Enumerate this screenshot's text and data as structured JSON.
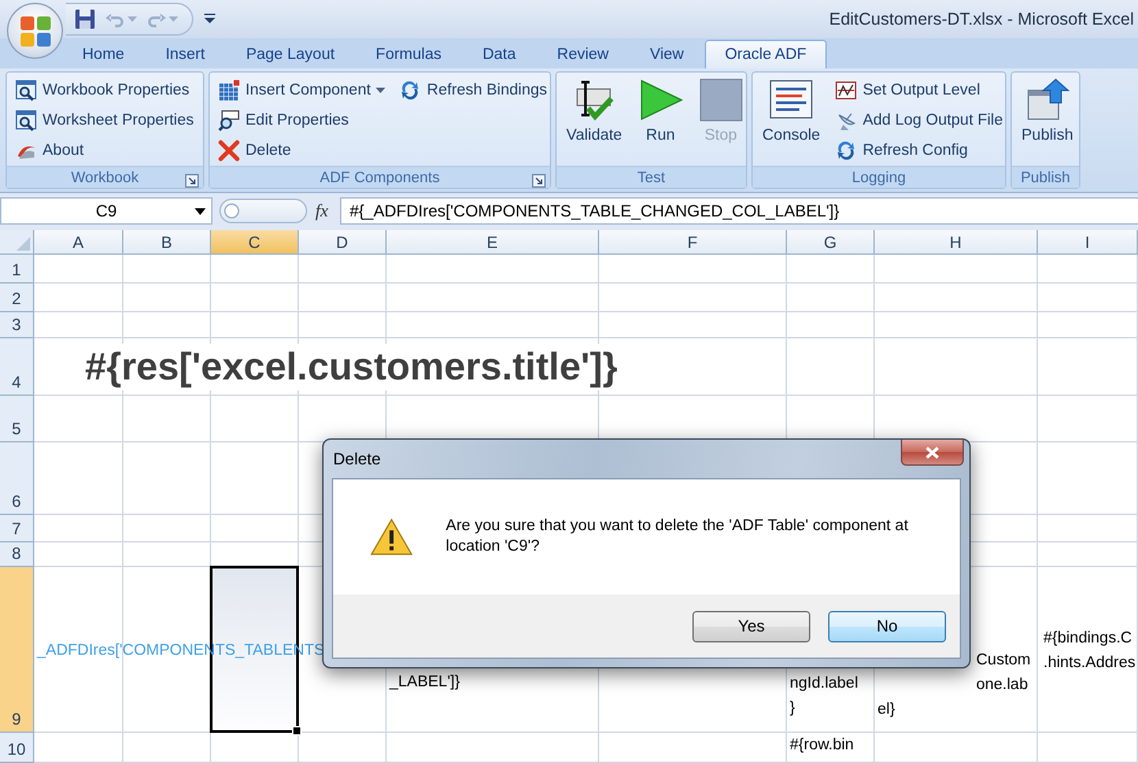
{
  "window": {
    "title": "EditCustomers-DT.xlsx - Microsoft Excel"
  },
  "tabs": [
    {
      "label": "Home",
      "selected": false
    },
    {
      "label": "Insert",
      "selected": false
    },
    {
      "label": "Page Layout",
      "selected": false
    },
    {
      "label": "Formulas",
      "selected": false
    },
    {
      "label": "Data",
      "selected": false
    },
    {
      "label": "Review",
      "selected": false
    },
    {
      "label": "View",
      "selected": false
    },
    {
      "label": "Oracle ADF",
      "selected": true
    }
  ],
  "ribbon_groups": [
    {
      "title": "Workbook",
      "launcher": true,
      "items": [
        {
          "label": "Workbook Properties",
          "kind": "small"
        },
        {
          "label": "Worksheet Properties",
          "kind": "small"
        },
        {
          "label": "About",
          "kind": "small"
        }
      ]
    },
    {
      "title": "ADF Components",
      "launcher": true,
      "items": [
        {
          "label": "Insert Component",
          "kind": "small",
          "dropdown": true
        },
        {
          "label": "Edit Properties",
          "kind": "small",
          "dropdown": false
        },
        {
          "label": "Delete",
          "kind": "small",
          "dropdown": false
        },
        {
          "label": "Refresh Bindings",
          "kind": "small",
          "dropdown": false
        }
      ]
    },
    {
      "title": "Test",
      "launcher": false,
      "items": [
        {
          "label": "Validate",
          "kind": "large",
          "disabled": false
        },
        {
          "label": "Run",
          "kind": "large",
          "disabled": false
        },
        {
          "label": "Stop",
          "kind": "large",
          "disabled": true
        }
      ]
    },
    {
      "title": "Logging",
      "launcher": false,
      "items": [
        {
          "label": "Console",
          "kind": "large"
        },
        {
          "label": "Set Output Level",
          "kind": "small"
        },
        {
          "label": "Add Log Output File",
          "kind": "small"
        },
        {
          "label": "Refresh Config",
          "kind": "small"
        }
      ]
    },
    {
      "title": "Publish",
      "launcher": false,
      "items": [
        {
          "label": "Publish",
          "kind": "large"
        }
      ]
    }
  ],
  "formula_bar": {
    "name_box": "C9",
    "function_label": "fx",
    "formula": "#{_ADFDIres['COMPONENTS_TABLE_CHANGED_COL_LABEL']}"
  },
  "columns": [
    {
      "label": "A",
      "selected": false
    },
    {
      "label": "B",
      "selected": false
    },
    {
      "label": "C",
      "selected": true
    },
    {
      "label": "D",
      "selected": false
    },
    {
      "label": "E",
      "selected": false
    },
    {
      "label": "F",
      "selected": false
    },
    {
      "label": "G",
      "selected": false
    },
    {
      "label": "H",
      "selected": false
    },
    {
      "label": "I",
      "selected": false
    }
  ],
  "rows": [
    {
      "header": "1",
      "selected": false
    },
    {
      "header": "2",
      "selected": false
    },
    {
      "header": "3",
      "selected": false
    },
    {
      "header": "4",
      "selected": false,
      "cells": [
        {
          "kind": "title",
          "lines": [
            "#{res['excel.customers.title']}"
          ]
        }
      ]
    },
    {
      "header": "5",
      "selected": false
    },
    {
      "header": "6",
      "selected": false
    },
    {
      "header": "7",
      "selected": false
    },
    {
      "header": "8",
      "selected": false
    },
    {
      "header": "9",
      "selected": true,
      "cells": [
        {
          "kind": "label",
          "lines": [
            "_ADFDIres['COMPONENTS_TABLENTS"
          ]
        },
        {
          "kind": "text",
          "lines": [
            "_LABEL']}"
          ]
        },
        {
          "kind": "text",
          "lines": [
            "ngId.label",
            "}"
          ]
        },
        {
          "kind": "text",
          "lines": [
            "Custom",
            "one.lab",
            "el}"
          ]
        },
        {
          "kind": "text",
          "lines": [
            "#{bindings.C",
            ".hints.Addres"
          ]
        }
      ]
    },
    {
      "header": "10",
      "selected": false,
      "cells": [
        {
          "kind": "text",
          "lines": [
            "#{row.bin"
          ]
        }
      ]
    }
  ],
  "dialog": {
    "title": "Delete",
    "message": "Are you sure that you want to delete the 'ADF Table' component at location 'C9'?",
    "buttons": [
      {
        "label": "Yes",
        "focused": false
      },
      {
        "label": "No",
        "focused": true
      }
    ]
  }
}
